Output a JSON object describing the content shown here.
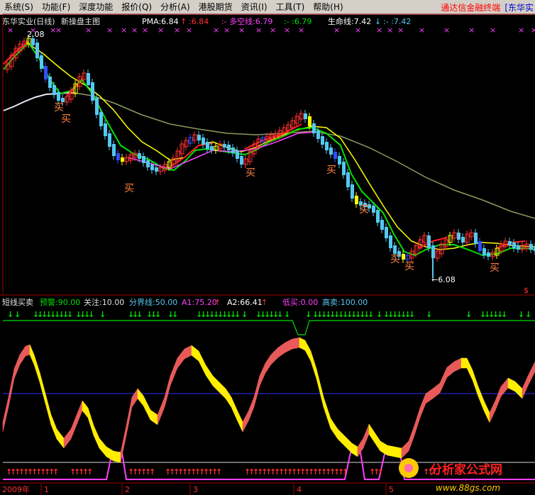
{
  "menu": {
    "items": [
      "系统(S)",
      "功能(F)",
      "深度功能",
      "报价(Q)",
      "分析(A)",
      "港股期货",
      "资讯(I)",
      "工具(T)",
      "帮助(H)"
    ],
    "brand": "通达信金融终端",
    "brand_extra": "[东华实"
  },
  "main_panel": {
    "title": "东华实业(日线)",
    "subtitle": "新操盘主图",
    "pma_label": "PMA:6.84",
    "pma_arrow": "↑",
    "pma_value2": ":6.84",
    "dkx_label": ":- 多空线:6.79",
    "dkx_value2": ":- :6.79",
    "life_label": "生命线:7.42",
    "life_arrow": "↓",
    "life_value2": ":- :7.42",
    "high_label": "2.08",
    "low_label": "←6.08",
    "buy_text": "买",
    "dollar": "$"
  },
  "sub_panel": {
    "title": "短线买卖",
    "warn": "预警:90.00",
    "focus": "关注:10.00",
    "divide": "分界线:50.00",
    "a1": "A1:75.20",
    "a1_arrow": "↑",
    "a2": "A2:66.41",
    "a2_arrow": "↑",
    "low_buy": "低买:0.00",
    "high_sell": "高卖:100.00"
  },
  "time_axis": {
    "year": "2009年",
    "months": [
      "1",
      "2",
      "3",
      "4",
      "5"
    ]
  },
  "watermark": {
    "text": "分析家公式网",
    "url": "www.88gs.com"
  },
  "colors": {
    "up": "#ff3030",
    "down": "#54c8f0",
    "yellow": "#ffff00",
    "green": "#00e000",
    "magenta": "#ff40ff",
    "white": "#f0f0f0",
    "olive": "#8c9a5a",
    "dark_red_line": "#a00000"
  }
}
